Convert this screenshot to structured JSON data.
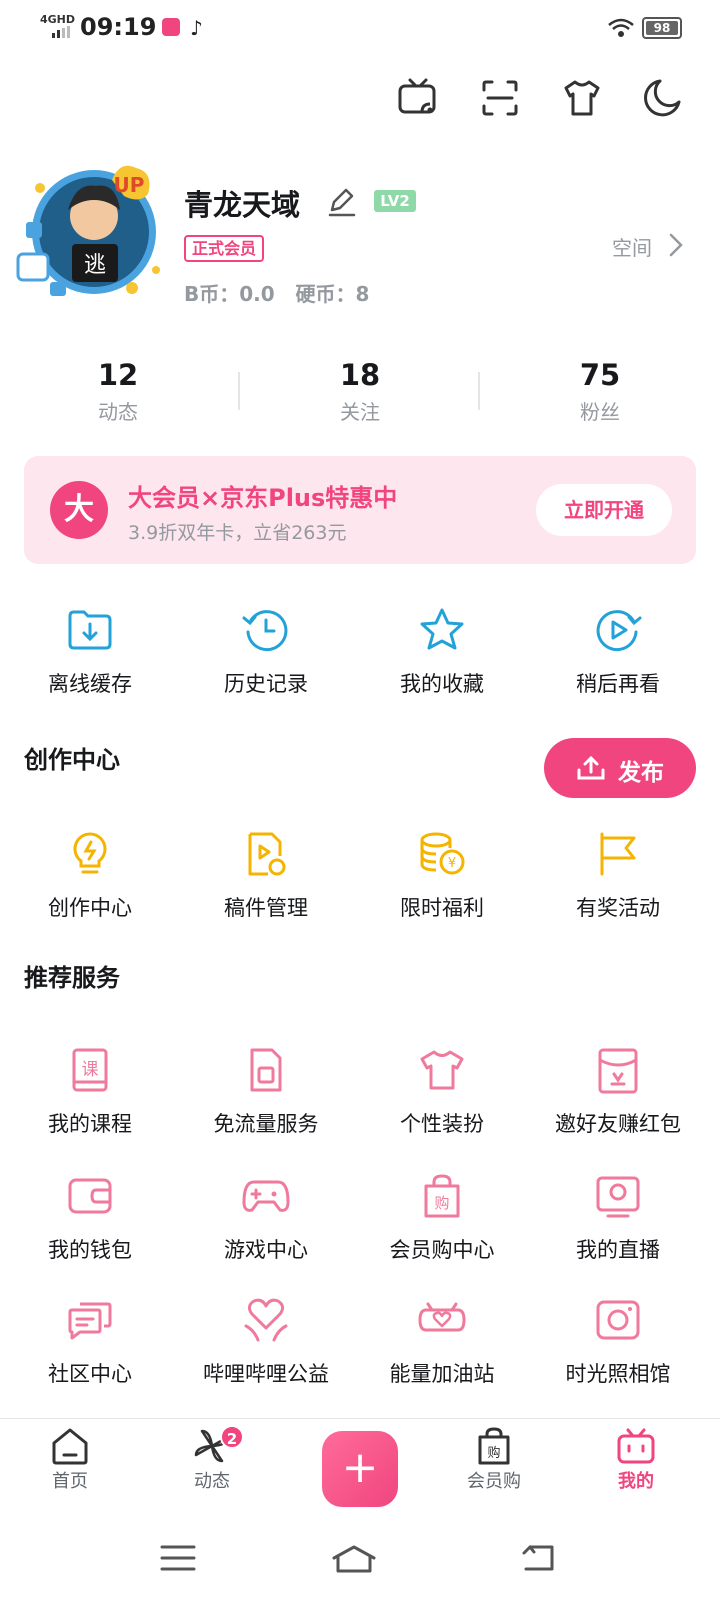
{
  "status_bar": {
    "network": "4GHD",
    "time": "09:19",
    "battery": "98"
  },
  "profile": {
    "username": "青龙天域",
    "level": "LV2",
    "membership": "正式会员",
    "coins_text": "B币：0.0   硬币：8",
    "space_label": "空间"
  },
  "stats": [
    {
      "value": "12",
      "label": "动态"
    },
    {
      "value": "18",
      "label": "关注"
    },
    {
      "value": "75",
      "label": "粉丝"
    }
  ],
  "vip_banner": {
    "icon_text": "大",
    "title": "大会员×京东Plus特惠中",
    "subtitle": "3.9折双年卡，立省263元",
    "button": "立即开通"
  },
  "quick_actions": [
    {
      "label": "离线缓存",
      "icon": "download-folder-icon"
    },
    {
      "label": "历史记录",
      "icon": "history-clock-icon"
    },
    {
      "label": "我的收藏",
      "icon": "star-icon"
    },
    {
      "label": "稍后再看",
      "icon": "watch-later-icon"
    }
  ],
  "creation_center": {
    "title": "创作中心",
    "publish_label": "发布",
    "items": [
      {
        "label": "创作中心",
        "icon": "lightbulb-icon"
      },
      {
        "label": "稿件管理",
        "icon": "manuscript-icon"
      },
      {
        "label": "限时福利",
        "icon": "coins-icon"
      },
      {
        "label": "有奖活动",
        "icon": "flag-icon"
      }
    ]
  },
  "recommended": {
    "title": "推荐服务",
    "items": [
      {
        "label": "我的课程",
        "icon": "course-book-icon"
      },
      {
        "label": "免流量服务",
        "icon": "sim-card-icon"
      },
      {
        "label": "个性装扮",
        "icon": "tshirt-icon"
      },
      {
        "label": "邀好友赚红包",
        "icon": "red-packet-icon"
      },
      {
        "label": "我的钱包",
        "icon": "wallet-icon"
      },
      {
        "label": "游戏中心",
        "icon": "gamepad-icon"
      },
      {
        "label": "会员购中心",
        "icon": "shopping-bag-icon"
      },
      {
        "label": "我的直播",
        "icon": "live-tv-icon"
      },
      {
        "label": "社区中心",
        "icon": "chat-bubbles-icon"
      },
      {
        "label": "哔哩哔哩公益",
        "icon": "heart-hands-icon"
      },
      {
        "label": "能量加油站",
        "icon": "energy-heart-icon"
      },
      {
        "label": "时光照相馆",
        "icon": "camera-icon"
      }
    ]
  },
  "bottom_nav": {
    "home": "首页",
    "dynamic": "动态",
    "dynamic_badge": "2",
    "plus": "+",
    "shop": "会员购",
    "mine": "我的"
  },
  "colors": {
    "accent": "#f0457f",
    "blue_icon": "#23a2d8",
    "yellow_icon": "#f5b400",
    "pink_icon": "#f07a9c",
    "muted": "#9499a0"
  }
}
